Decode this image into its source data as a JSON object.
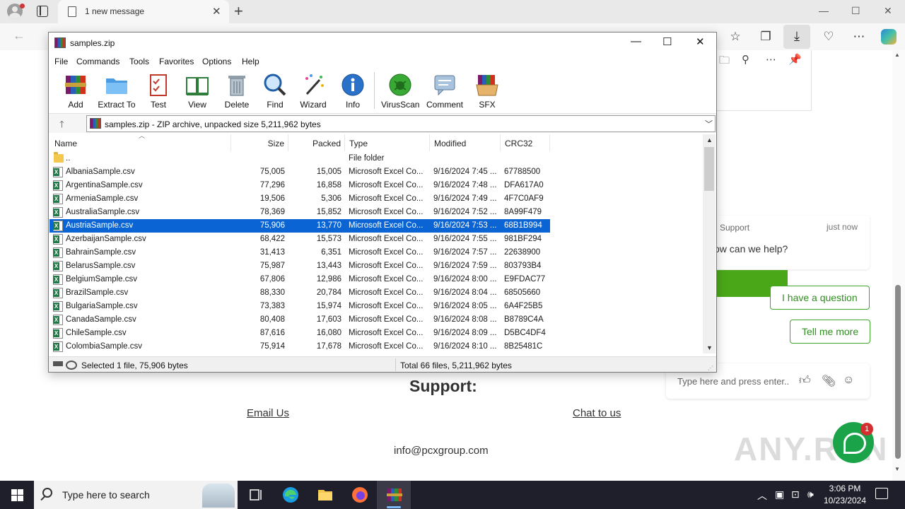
{
  "browser": {
    "tab_title": "1 new message",
    "tab_close": "✕",
    "new_tab": "+",
    "min": "—",
    "max": "☐",
    "close": "✕"
  },
  "webpage": {
    "chat": {
      "agent": "Support",
      "time": "just now",
      "message": "ow can we help?",
      "options": [
        "I have a question",
        "Tell me more"
      ],
      "input_placeholder": "Type here and press enter..",
      "badge": "1"
    },
    "support": {
      "title": "Support:",
      "email_link": "Email Us",
      "chat_link": "Chat to us",
      "email": "info@pcxgroup.com"
    },
    "watermark": "ANY.RUN"
  },
  "winrar": {
    "title": "samples.zip",
    "menu": [
      "File",
      "Commands",
      "Tools",
      "Favorites",
      "Options",
      "Help"
    ],
    "tools": [
      {
        "label": "Add",
        "icon": "add-archive-icon"
      },
      {
        "label": "Extract To",
        "icon": "extract-folder-icon"
      },
      {
        "label": "Test",
        "icon": "test-checklist-icon"
      },
      {
        "label": "View",
        "icon": "book-view-icon"
      },
      {
        "label": "Delete",
        "icon": "trash-can-icon"
      },
      {
        "label": "Find",
        "icon": "magnifier-icon"
      },
      {
        "label": "Wizard",
        "icon": "magic-wand-icon"
      },
      {
        "label": "Info",
        "icon": "info-icon"
      },
      {
        "label": "VirusScan",
        "icon": "virus-scan-icon"
      },
      {
        "label": "Comment",
        "icon": "comment-icon"
      },
      {
        "label": "SFX",
        "icon": "sfx-box-icon"
      }
    ],
    "path": "samples.zip - ZIP archive, unpacked size 5,211,962 bytes",
    "columns": [
      "Name",
      "Size",
      "Packed",
      "Type",
      "Modified",
      "CRC32"
    ],
    "parent_row": {
      "name": "..",
      "type": "File folder"
    },
    "rows": [
      {
        "name": "AlbaniaSample.csv",
        "size": "75,005",
        "packed": "15,005",
        "type": "Microsoft Excel Co...",
        "modified": "9/16/2024 7:45 ...",
        "crc": "67788500",
        "selected": false
      },
      {
        "name": "ArgentinaSample.csv",
        "size": "77,296",
        "packed": "16,858",
        "type": "Microsoft Excel Co...",
        "modified": "9/16/2024 7:48 ...",
        "crc": "DFA617A0",
        "selected": false
      },
      {
        "name": "ArmeniaSample.csv",
        "size": "19,506",
        "packed": "5,306",
        "type": "Microsoft Excel Co...",
        "modified": "9/16/2024 7:49 ...",
        "crc": "4F7C0AF9",
        "selected": false
      },
      {
        "name": "AustraliaSample.csv",
        "size": "78,369",
        "packed": "15,852",
        "type": "Microsoft Excel Co...",
        "modified": "9/16/2024 7:52 ...",
        "crc": "8A99F479",
        "selected": false
      },
      {
        "name": "AustriaSample.csv",
        "size": "75,906",
        "packed": "13,770",
        "type": "Microsoft Excel Co...",
        "modified": "9/16/2024 7:53 ...",
        "crc": "68B1B994",
        "selected": true
      },
      {
        "name": "AzerbaijanSample.csv",
        "size": "68,422",
        "packed": "15,573",
        "type": "Microsoft Excel Co...",
        "modified": "9/16/2024 7:55 ...",
        "crc": "981BF294",
        "selected": false
      },
      {
        "name": "BahrainSample.csv",
        "size": "31,413",
        "packed": "6,351",
        "type": "Microsoft Excel Co...",
        "modified": "9/16/2024 7:57 ...",
        "crc": "22638900",
        "selected": false
      },
      {
        "name": "BelarusSample.csv",
        "size": "75,987",
        "packed": "13,443",
        "type": "Microsoft Excel Co...",
        "modified": "9/16/2024 7:59 ...",
        "crc": "803793B4",
        "selected": false
      },
      {
        "name": "BelgiumSample.csv",
        "size": "67,806",
        "packed": "12,986",
        "type": "Microsoft Excel Co...",
        "modified": "9/16/2024 8:00 ...",
        "crc": "E9FDAC77",
        "selected": false
      },
      {
        "name": "BrazilSample.csv",
        "size": "88,330",
        "packed": "20,784",
        "type": "Microsoft Excel Co...",
        "modified": "9/16/2024 8:04 ...",
        "crc": "68505660",
        "selected": false
      },
      {
        "name": "BulgariaSample.csv",
        "size": "73,383",
        "packed": "15,974",
        "type": "Microsoft Excel Co...",
        "modified": "9/16/2024 8:05 ...",
        "crc": "6A4F25B5",
        "selected": false
      },
      {
        "name": "CanadaSample.csv",
        "size": "80,408",
        "packed": "17,603",
        "type": "Microsoft Excel Co...",
        "modified": "9/16/2024 8:08 ...",
        "crc": "B8789C4A",
        "selected": false
      },
      {
        "name": "ChileSample.csv",
        "size": "87,616",
        "packed": "16,080",
        "type": "Microsoft Excel Co...",
        "modified": "9/16/2024 8:09 ...",
        "crc": "D5BC4DF4",
        "selected": false
      },
      {
        "name": "ColombiaSample.csv",
        "size": "75,914",
        "packed": "17,678",
        "type": "Microsoft Excel Co...",
        "modified": "9/16/2024 8:10 ...",
        "crc": "8B25481C",
        "selected": false
      }
    ],
    "status_left": "Selected 1 file, 75,906 bytes",
    "status_right": "Total 66 files, 5,211,962 bytes"
  },
  "taskbar": {
    "search_placeholder": "Type here to search",
    "time": "3:06 PM",
    "date": "10/23/2024"
  },
  "colors": {
    "selection": "#0a64d3",
    "chat_green": "#4aa818",
    "taskbar": "#1f1f2b"
  }
}
